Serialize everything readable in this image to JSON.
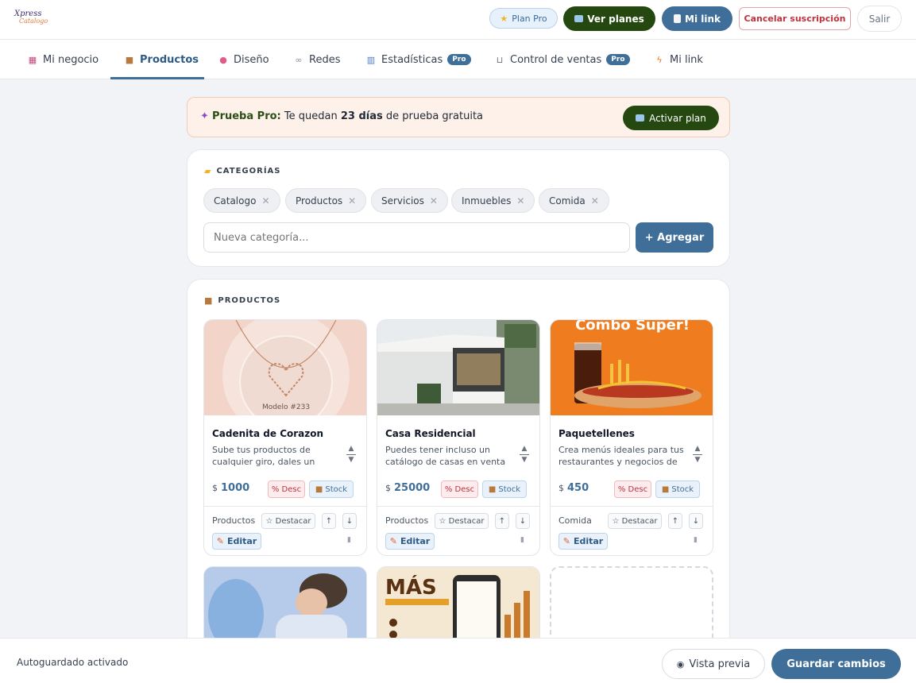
{
  "header": {
    "logo_line1": "Xpress",
    "logo_line2": "Catalogo",
    "plan_pro": "Plan Pro",
    "ver_planes": "Ver planes",
    "mi_link": "Mi link",
    "cancelar": "Cancelar suscripción",
    "salir": "Salir"
  },
  "tabs": [
    {
      "label": "Mi negocio",
      "icon": "store-icon"
    },
    {
      "label": "Productos",
      "icon": "box-icon"
    },
    {
      "label": "Diseño",
      "icon": "palette-icon"
    },
    {
      "label": "Redes",
      "icon": "link-icon"
    },
    {
      "label": "Estadísticas",
      "icon": "chart-icon",
      "badge": "Pro"
    },
    {
      "label": "Control de ventas",
      "icon": "cart-icon",
      "badge": "Pro"
    },
    {
      "label": "Mi link",
      "icon": "bolt-icon"
    }
  ],
  "trial": {
    "label": "Prueba Pro:",
    "text_before": "Te quedan",
    "days": "23 días",
    "text_after": "de prueba gratuita",
    "button": "Activar plan"
  },
  "categories": {
    "title": "CATEGORÍAS",
    "items": [
      "Catalogo",
      "Productos",
      "Servicios",
      "Inmuebles",
      "Comida"
    ],
    "input_placeholder": "Nueva categoría...",
    "add_button": "+ Agregar"
  },
  "products": {
    "title": "PRODUCTOS",
    "currency": "$",
    "desc_tag": "% Desc",
    "stock_tag": "Stock",
    "destacar": "☆ Destacar",
    "editar": "Editar",
    "items": [
      {
        "name": "Cadenita de Corazon",
        "description": "Sube tus productos de cualquier giro, dales un",
        "price": "1000",
        "category": "Productos",
        "image_caption": "Modelo #233"
      },
      {
        "name": "Casa Residencial",
        "description": "Puedes tener incluso un catálogo de casas en venta o",
        "price": "25000",
        "category": "Productos"
      },
      {
        "name": "Paquetellenes",
        "description": "Crea menús ideales para tus restaurantes y negocios de",
        "price": "450",
        "category": "Comida",
        "image_caption": "Combo Super!"
      }
    ],
    "partial_image_text": "MÁS"
  },
  "footer": {
    "autosave": "Autoguardado activado",
    "preview": "Vista previa",
    "save": "Guardar cambios"
  }
}
